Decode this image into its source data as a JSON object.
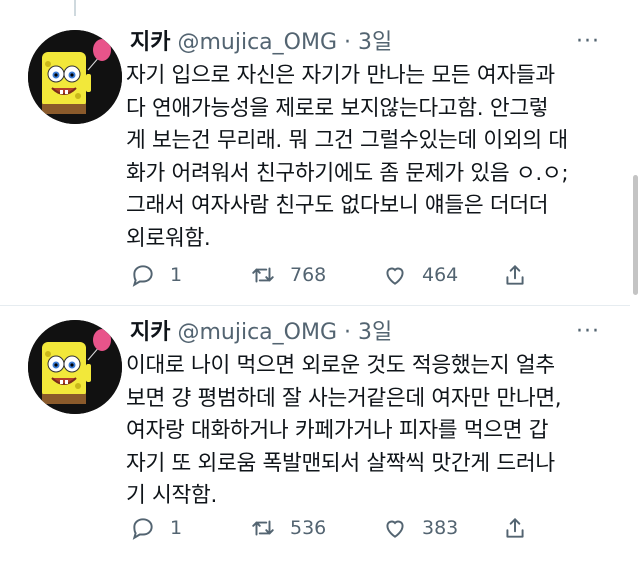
{
  "tweets": [
    {
      "display_name": "지카",
      "handle": "@mujica_OMG",
      "separator": "·",
      "time": "3일",
      "text": "자기 입으로 자신은 자기가 만나는 모든 여자들과\n다 연애가능성을 제로로 보지않는다고함. 안그렇\n게 보는건 무리래. 뭐 그건 그럴수있는데 이외의 대\n화가 어려워서 친구하기에도 좀 문제가 있음 ㅇ.ㅇ;\n그래서 여자사람 친구도 없다보니 얘들은 더더더\n외로워함.",
      "replies": "1",
      "retweets": "768",
      "likes": "464"
    },
    {
      "display_name": "지카",
      "handle": "@mujica_OMG",
      "separator": "·",
      "time": "3일",
      "text": "이대로 나이 먹으면 외로운 것도 적응했는지 얼추\n보면 걍 평범하데 잘 사는거같은데 여자만 만나면,\n여자랑 대화하거나 카페가거나 피자를 먹으면 갑\n자기 또 외로움 폭발맨되서 살짝씩 맛간게 드러나\n기 시작함.",
      "replies": "1",
      "retweets": "536",
      "likes": "383"
    }
  ],
  "icons": {
    "avatar": "spongebob-avatar-icon",
    "more": "more-options-icon",
    "reply": "reply-icon",
    "retweet": "retweet-icon",
    "like": "like-icon",
    "share": "share-icon"
  },
  "colors": {
    "text": "#0f1419",
    "secondary": "#536471",
    "divider": "#e6ecf0",
    "avatar_bg": "#111111",
    "sponge_yellow": "#f2e83a",
    "balloon_pink": "#e8548a"
  }
}
